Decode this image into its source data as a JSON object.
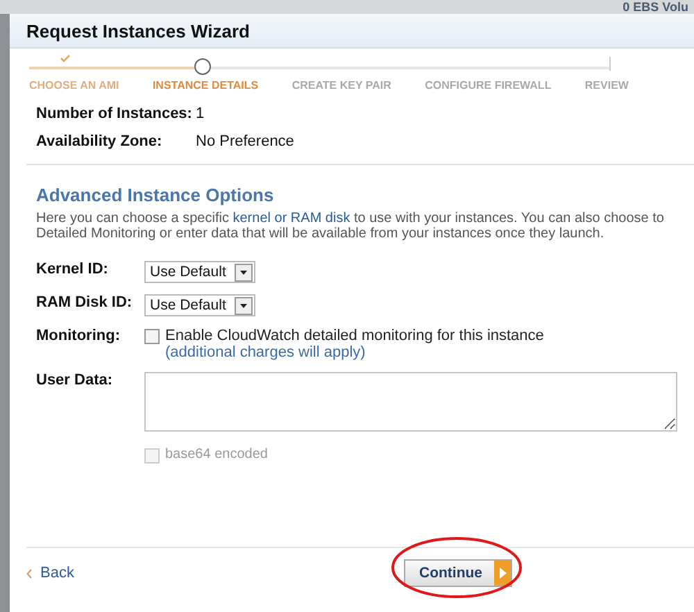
{
  "background": {
    "label": "0 EBS Volu"
  },
  "window": {
    "title": "Request Instances Wizard"
  },
  "steps": [
    {
      "label": "CHOOSE AN AMI",
      "completed": true,
      "selected": false
    },
    {
      "label": "INSTANCE DETAILS",
      "completed": false,
      "selected": true
    },
    {
      "label": "CREATE KEY PAIR",
      "completed": false,
      "selected": false
    },
    {
      "label": "CONFIGURE FIREWALL",
      "completed": false,
      "selected": false
    },
    {
      "label": "REVIEW",
      "completed": false,
      "selected": false
    }
  ],
  "summary": [
    {
      "label": "Number of Instances:",
      "value": "1"
    },
    {
      "label": "Availability Zone:",
      "value": "No Preference"
    }
  ],
  "advanced": {
    "title": "Advanced Instance Options",
    "description": {
      "before": "Here you can choose a specific ",
      "link": "kernel or RAM disk",
      "after": " to use with your instances. You can also choose to",
      "line_2": "Detailed Monitoring or enter data that will be available from your instances once they launch."
    },
    "fields": [
      {
        "kind": "select",
        "label": "Kernel ID:",
        "value": "Use Default"
      },
      {
        "kind": "select",
        "label": "RAM Disk ID:",
        "value": "Use Default"
      },
      {
        "kind": "checkbox",
        "label": "Monitoring:",
        "option": "Enable CloudWatch detailed monitoring for this instance",
        "note": "(additional charges will apply)",
        "checked": false,
        "disabled": false
      },
      {
        "kind": "textarea",
        "label": "User Data:",
        "option": "base64 encoded",
        "checked": false,
        "disabled": true
      }
    ]
  },
  "footer": {
    "back": "Back",
    "continue": "Continue"
  }
}
